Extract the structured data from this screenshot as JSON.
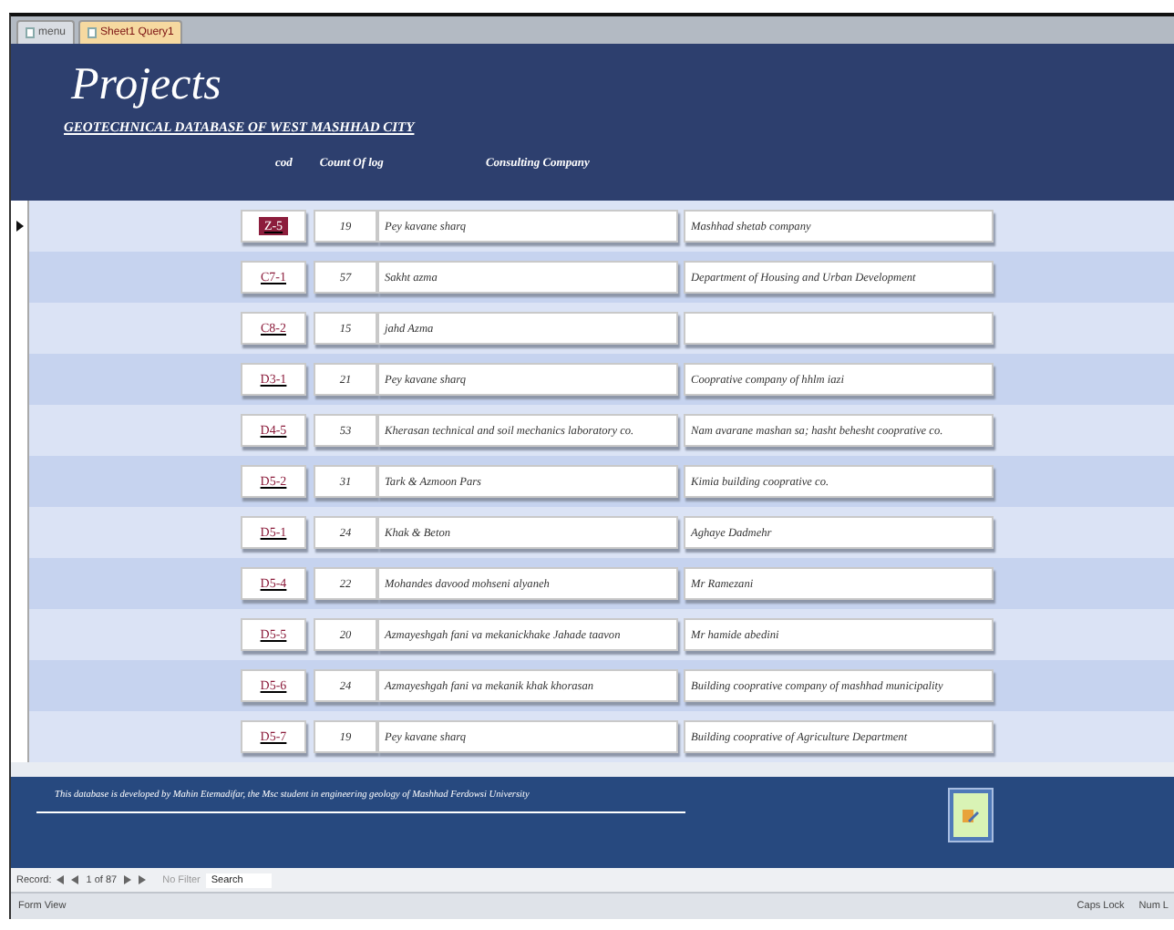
{
  "tabs": [
    {
      "label": "menu",
      "selected": false
    },
    {
      "label": "Sheet1 Query1",
      "selected": true
    }
  ],
  "header": {
    "title": "Projects",
    "subtitle": "GEOTECHNICAL DATABASE OF WEST MASHHAD CITY",
    "columns": [
      "cod",
      "Count Of log",
      "Consulting Company"
    ]
  },
  "rows": [
    {
      "code": "Z-5",
      "count": "19",
      "consultant": "Pey kavane sharq",
      "client": "Mashhad shetab company",
      "selected": true
    },
    {
      "code": "C7-1",
      "count": "57",
      "consultant": "Sakht azma",
      "client": "Department of Housing and Urban Development",
      "selected": false
    },
    {
      "code": "C8-2",
      "count": "15",
      "consultant": "jahd Azma",
      "selected": false
    },
    {
      "code": "D3-1",
      "count": "21",
      "consultant": "Pey kavane sharq",
      "client": "Cooprative company of hhlm iazi",
      "selected": false
    },
    {
      "code": "D4-5",
      "count": "53",
      "consultant": "Kherasan technical and soil mechanics laboratory co.",
      "client": "Nam avarane mashan sa; hasht behesht cooprative co.",
      "selected": false
    },
    {
      "code": "D5-2",
      "count": "31",
      "consultant": "Tark & Azmoon Pars",
      "client": "Kimia building cooprative co.",
      "selected": false
    },
    {
      "code": "D5-1",
      "count": "24",
      "consultant": "Khak & Beton",
      "client": "Aghaye Dadmehr",
      "selected": false
    },
    {
      "code": "D5-4",
      "count": "22",
      "consultant": "Mohandes davood mohseni alyaneh",
      "client": "Mr Ramezani",
      "selected": false
    },
    {
      "code": "D5-5",
      "count": "20",
      "consultant": "Azmayeshgah fani va  mekanickhake Jahade taavon",
      "client": "Mr hamide abedini",
      "selected": false
    },
    {
      "code": "D5-6",
      "count": "24",
      "consultant": "Azmayeshgah fani va mekanik khak khorasan",
      "client": "Building cooprative company of mashhad  municipality",
      "selected": false
    },
    {
      "code": "D5-7",
      "count": "19",
      "consultant": "Pey kavane sharq",
      "client": "Building cooprative of Agriculture Department",
      "selected": false
    }
  ],
  "footer": {
    "note": "This database is developed by Mahin Etemadifar, the Msc student in engineering geology of Mashhad Ferdowsi University"
  },
  "record_nav": {
    "label": "Record:",
    "position": "1 of 87",
    "filter": "No Filter",
    "search": "Search"
  },
  "status_bar": {
    "view": "Form View",
    "indicators": [
      "Caps Lock",
      "Num L"
    ]
  }
}
